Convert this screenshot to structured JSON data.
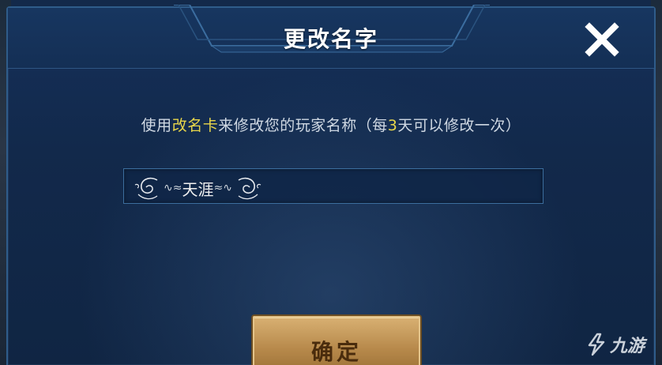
{
  "dialog": {
    "title": "更改名字",
    "close_icon": "close-icon"
  },
  "instruction": {
    "prefix": "使用",
    "item_name": "改名卡",
    "middle": "来修改您的玩家名称（每",
    "days": "3",
    "suffix": "天可以修改一次）",
    "highlight_color": "#e8d64a"
  },
  "name_input": {
    "value": "天涯",
    "ornament_left": "∿≈",
    "ornament_right": "≈∿"
  },
  "confirm_button": {
    "label": "确定"
  },
  "watermark": {
    "text": "九游",
    "icon": "nine-game-logo-icon"
  }
}
